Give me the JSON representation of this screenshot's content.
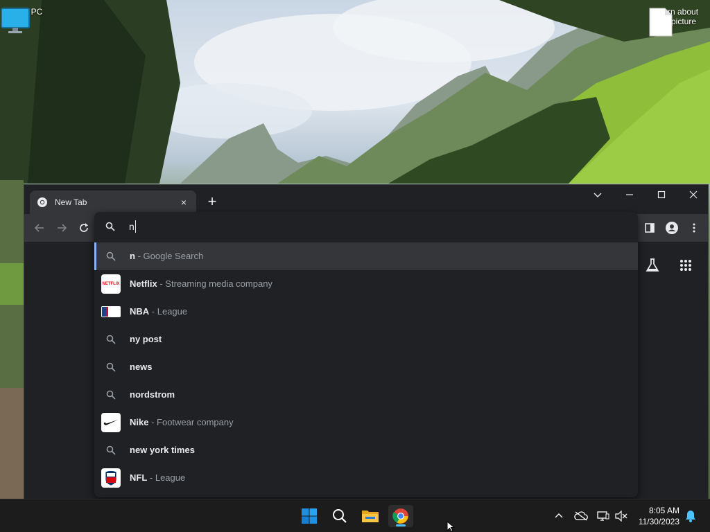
{
  "desktop": {
    "icons": [
      {
        "label": "This PC"
      },
      {
        "label": "Learn about this picture"
      }
    ]
  },
  "browser": {
    "tab": {
      "title": "New Tab",
      "close": "×"
    },
    "new_tab": "+",
    "omnibox": {
      "value": "n"
    },
    "suggestions": [
      {
        "main": "n",
        "sep": " - ",
        "desc": "Google Search",
        "icon": "search-icon",
        "selected": true
      },
      {
        "main": "Netflix",
        "sep": " - ",
        "desc": "Streaming media company",
        "icon": "netflix-logo"
      },
      {
        "main": "NBA",
        "sep": " - ",
        "desc": "League",
        "icon": "nba-logo"
      },
      {
        "main": "ny post",
        "icon": "search-icon"
      },
      {
        "main": "news",
        "icon": "search-icon"
      },
      {
        "main": "nordstrom",
        "icon": "search-icon"
      },
      {
        "main": "Nike",
        "sep": " - ",
        "desc": "Footwear company",
        "icon": "nike-logo"
      },
      {
        "main": "new york times",
        "icon": "search-icon"
      },
      {
        "main": "NFL",
        "sep": " - ",
        "desc": "League",
        "icon": "nfl-logo"
      }
    ],
    "netflix_logo_text": "NETFLIX"
  },
  "taskbar": {
    "time": "8:05 AM",
    "date": "11/30/2023"
  },
  "colors": {
    "accent": "#8ab4f8",
    "taskbar_indicator": "#4cc2ff",
    "windows_blue": "#0078d4"
  }
}
